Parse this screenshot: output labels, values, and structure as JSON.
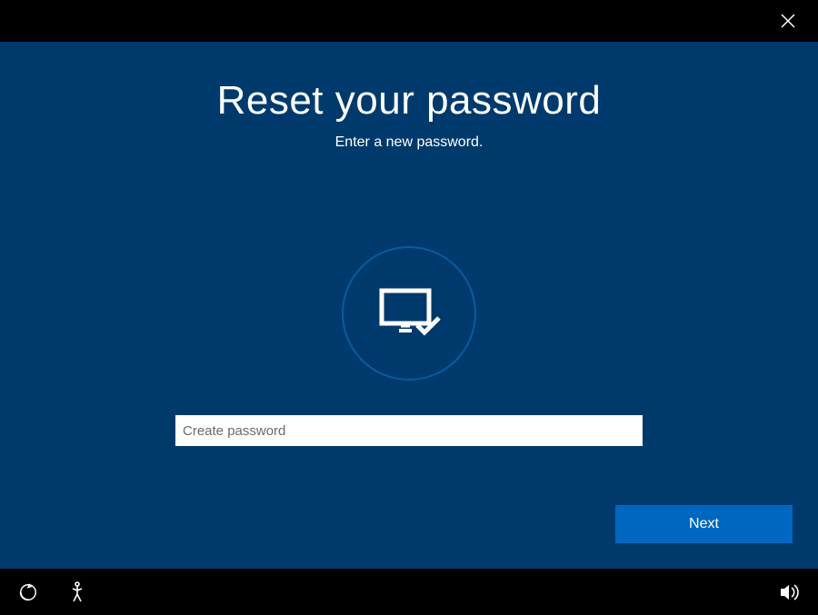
{
  "header": {
    "title": "Reset your password",
    "subtitle": "Enter a new password."
  },
  "form": {
    "password_placeholder": "Create password",
    "password_value": ""
  },
  "actions": {
    "next_label": "Next"
  },
  "icons": {
    "close": "close-icon",
    "monitor": "monitor-check-icon",
    "ease_of_access": "ease-of-access-icon",
    "accessibility_alt": "accessibility-icon",
    "volume": "volume-icon"
  },
  "colors": {
    "background": "#003a6c",
    "accent": "#0067c0",
    "ring": "#0a5aa0"
  }
}
